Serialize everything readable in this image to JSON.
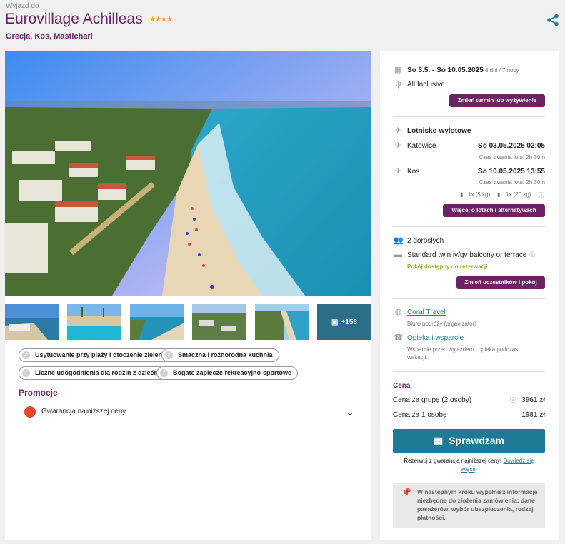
{
  "header": {
    "pre": "Wyjazd do",
    "title": "Eurovillage Achilleas",
    "stars": "★★★★",
    "location": "Grecja, Kos, Mastichari"
  },
  "gallery": {
    "more_label": "+153"
  },
  "features": [
    "Usytuowanie przy plaży i otoczenie zieleni",
    "Smaczna i różnorodna kuchnia",
    "Liczne udogodnienia dla rodzin z dziećmi",
    "Bogate zaplecze rekreacyjno-sportowe"
  ],
  "promotions": {
    "heading": "Promocje",
    "item": "Gwarancja najniższej ceny"
  },
  "booking": {
    "dates": "So 3.5. - So 10.05.2025",
    "duration": "8 dni / 7 nocy",
    "board": "All Inclusive",
    "change_date_btn": "Zmień termin lub wyżywienie",
    "airport_heading": "Lotnisko wylotowe",
    "out_city": "Katowice",
    "out_date": "So 03.05.2025 02:05",
    "out_duration": "Czas trwania lotu: 2h 30m",
    "ret_city": "Kos",
    "ret_date": "So 10.05.2025 13:55",
    "ret_duration": "Czas trwania lotu: 2h 30m",
    "bag_small": "1x (5 kg)",
    "bag_large": "1x (20 kg)",
    "flights_btn": "Więcej o lotach i alternatywach",
    "guests": "2 dorosłych",
    "room": "Standard twin iv/gv balcony or terrace",
    "room_status": "Pokój dostępny do rezerwacji",
    "guests_btn": "Zmień uczestników i pokój",
    "organizer_name": "Coral Travel",
    "organizer_role": "Biuro podróży (organizator)",
    "support_name": "Opieka i wsparcie",
    "support_desc_1": "Wsparcie przed wyjazdem i opieka podczas",
    "support_desc_2": "wakacji."
  },
  "price": {
    "heading": "Cena",
    "group_label": "Cena za grupę (2 osoby)",
    "group_value": "3961 zł",
    "person_label": "Cena za 1 osobę",
    "person_value": "1981 zł",
    "check_btn": "Sprawdzam",
    "guarantee_text": "Rezerwuj z gwarancją najniższej ceny!",
    "guarantee_link_1": "Dowiedz się",
    "guarantee_link_2": "więcej",
    "note": "W następnym kroku wypełnisz informacje niezbędne do złożenia zamówienia: dane pasażerów, wybór ubezpieczenia, rodzaj płatności."
  },
  "colors": {
    "brand": "#6b2463",
    "accent": "#1f7b93",
    "available": "#8bb820",
    "star": "#f3a712"
  }
}
